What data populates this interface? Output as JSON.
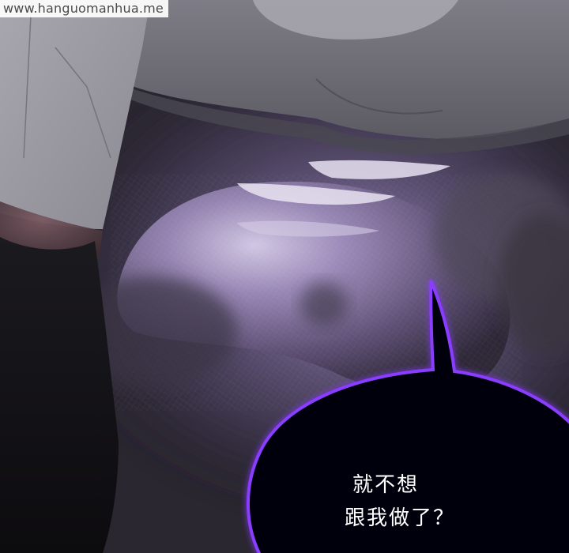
{
  "watermark": {
    "text": "www.hanguomanhua.me"
  },
  "speech_bubble": {
    "line1": "就不想",
    "line2": "跟我做了？",
    "glow_color": "#8a3cff",
    "fill_color": "#050208"
  },
  "palette": {
    "background_dark": "#2a2730",
    "mist_purple": "#6b5a8c",
    "shirt_gray": "#8f8e96",
    "shadow_gray": "#5e5d66"
  }
}
